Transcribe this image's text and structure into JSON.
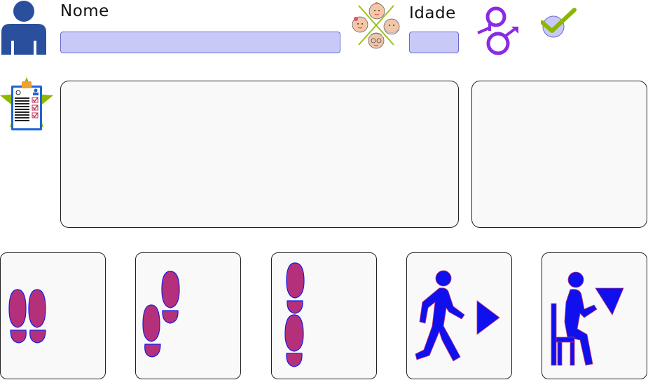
{
  "form": {
    "name_label": "Nome",
    "name_value": "",
    "age_label": "Idade",
    "age_value": ""
  },
  "icons": {
    "user": "person-silhouette-icon",
    "age_groups": "age-groups-faces-icon",
    "gender": "gender-symbols-icon",
    "confirm": "checkmark-icon",
    "checklist": "clipboard-checklist-star-icon"
  },
  "cards": [
    {
      "name": "feet-together-card",
      "icon": "feet-side-by-side-icon"
    },
    {
      "name": "semi-tandem-card",
      "icon": "feet-semi-tandem-icon"
    },
    {
      "name": "tandem-card",
      "icon": "feet-tandem-icon"
    },
    {
      "name": "walk-card",
      "icon": "walking-person-play-icon"
    },
    {
      "name": "sit-to-stand-card",
      "icon": "person-chair-stand-icon"
    }
  ],
  "colors": {
    "field_fill": "#c8c9f7",
    "user_icon": "#2a4f9c",
    "footprint": "#b5307a",
    "footprint_outline": "#1a1ae6",
    "action_blue": "#1010ee",
    "gender_purple": "#8a2be2",
    "check_green": "#8db600"
  }
}
